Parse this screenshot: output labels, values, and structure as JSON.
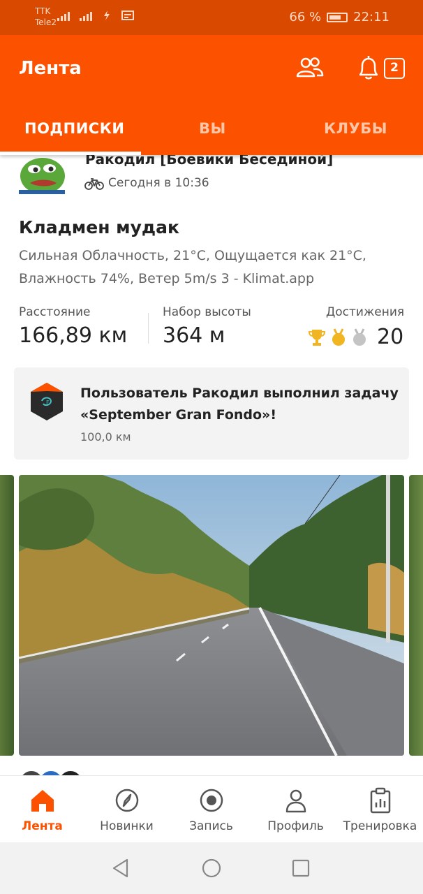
{
  "status_bar": {
    "carrier1": "TTK",
    "carrier2": "Tele2",
    "battery": "66 %",
    "time": "22:11"
  },
  "header": {
    "title": "Лента",
    "notification_count": "2"
  },
  "tabs": [
    {
      "label": "ПОДПИСКИ",
      "active": true
    },
    {
      "label": "ВЫ",
      "active": false
    },
    {
      "label": "КЛУБЫ",
      "active": false
    }
  ],
  "post": {
    "athlete": "Ракодил  [Боевики Бесединой]",
    "time": "Сегодня в 10:36",
    "title": "Кладмен мудак",
    "description": "Сильная Облачность, 21°C, Ощущается как 21°C, Влажность 74%, Ветер 5m/s  3 - Klimat.app",
    "stats": [
      {
        "label": "Расстояние",
        "value": "166,89 км"
      },
      {
        "label": "Набор высоты",
        "value": "364 м"
      },
      {
        "label": "Достижения",
        "value": "20"
      }
    ],
    "challenge": {
      "text": "Пользователь Ракодил  выполнил задачу «September Gran Fondo»!",
      "sub": "100,0 км"
    }
  },
  "bottom_nav": [
    {
      "label": "Лента",
      "icon": "home-icon",
      "active": true
    },
    {
      "label": "Новинки",
      "icon": "compass-icon",
      "active": false
    },
    {
      "label": "Запись",
      "icon": "record-icon",
      "active": false
    },
    {
      "label": "Профиль",
      "icon": "profile-icon",
      "active": false
    },
    {
      "label": "Тренировка",
      "icon": "training-icon",
      "active": false
    }
  ],
  "colors": {
    "brand": "#fc5200",
    "status_bar": "#d94a00"
  }
}
